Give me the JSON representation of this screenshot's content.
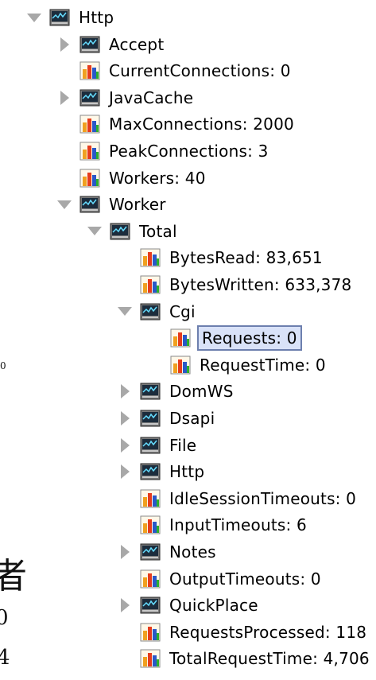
{
  "tree": {
    "selected_item": "Requests",
    "nodes": [
      {
        "label": "Http",
        "kind": "folder",
        "state": "expanded",
        "level": 0
      },
      {
        "label": "Accept",
        "kind": "folder",
        "state": "collapsed",
        "level": 1
      },
      {
        "label": "CurrentConnections: 0",
        "kind": "stat",
        "state": "leaf",
        "level": 1
      },
      {
        "label": "JavaCache",
        "kind": "folder",
        "state": "collapsed",
        "level": 1
      },
      {
        "label": "MaxConnections: 2000",
        "kind": "stat",
        "state": "leaf",
        "level": 1
      },
      {
        "label": "PeakConnections: 3",
        "kind": "stat",
        "state": "leaf",
        "level": 1
      },
      {
        "label": "Workers: 40",
        "kind": "stat",
        "state": "leaf",
        "level": 1
      },
      {
        "label": "Worker",
        "kind": "folder",
        "state": "expanded",
        "level": 1
      },
      {
        "label": "Total",
        "kind": "folder",
        "state": "expanded",
        "level": 2
      },
      {
        "label": "BytesRead: 83,651",
        "kind": "stat",
        "state": "leaf",
        "level": 3
      },
      {
        "label": "BytesWritten: 633,378",
        "kind": "stat",
        "state": "leaf",
        "level": 3
      },
      {
        "label": "Cgi",
        "kind": "folder",
        "state": "expanded",
        "level": 3
      },
      {
        "label": "Requests: 0",
        "kind": "stat",
        "state": "leaf",
        "level": 4,
        "selected": true
      },
      {
        "label": "RequestTime: 0",
        "kind": "stat",
        "state": "leaf",
        "level": 4
      },
      {
        "label": "DomWS",
        "kind": "folder",
        "state": "collapsed",
        "level": 3
      },
      {
        "label": "Dsapi",
        "kind": "folder",
        "state": "collapsed",
        "level": 3
      },
      {
        "label": "File",
        "kind": "folder",
        "state": "collapsed",
        "level": 3
      },
      {
        "label": "Http",
        "kind": "folder",
        "state": "collapsed",
        "level": 3
      },
      {
        "label": "IdleSessionTimeouts: 0",
        "kind": "stat",
        "state": "leaf",
        "level": 3
      },
      {
        "label": "InputTimeouts: 6",
        "kind": "stat",
        "state": "leaf",
        "level": 3
      },
      {
        "label": "Notes",
        "kind": "folder",
        "state": "collapsed",
        "level": 3
      },
      {
        "label": "OutputTimeouts: 0",
        "kind": "stat",
        "state": "leaf",
        "level": 3
      },
      {
        "label": "QuickPlace",
        "kind": "folder",
        "state": "collapsed",
        "level": 3
      },
      {
        "label": "RequestsProcessed: 118",
        "kind": "stat",
        "state": "leaf",
        "level": 3
      },
      {
        "label": "TotalRequestTime: 4,706",
        "kind": "stat",
        "state": "leaf",
        "level": 3
      }
    ]
  },
  "background_fragments": {
    "char_a": "0",
    "char_b": "者",
    "char_c": "0",
    "char_d": "4"
  },
  "icons": {
    "folder": "monitor-folder-icon",
    "stat": "bar-chart-stat-icon"
  },
  "colors": {
    "twisty": "#a8a8a8",
    "selection_border": "#6d7fae",
    "selection_fill": "#d9e2f8"
  }
}
